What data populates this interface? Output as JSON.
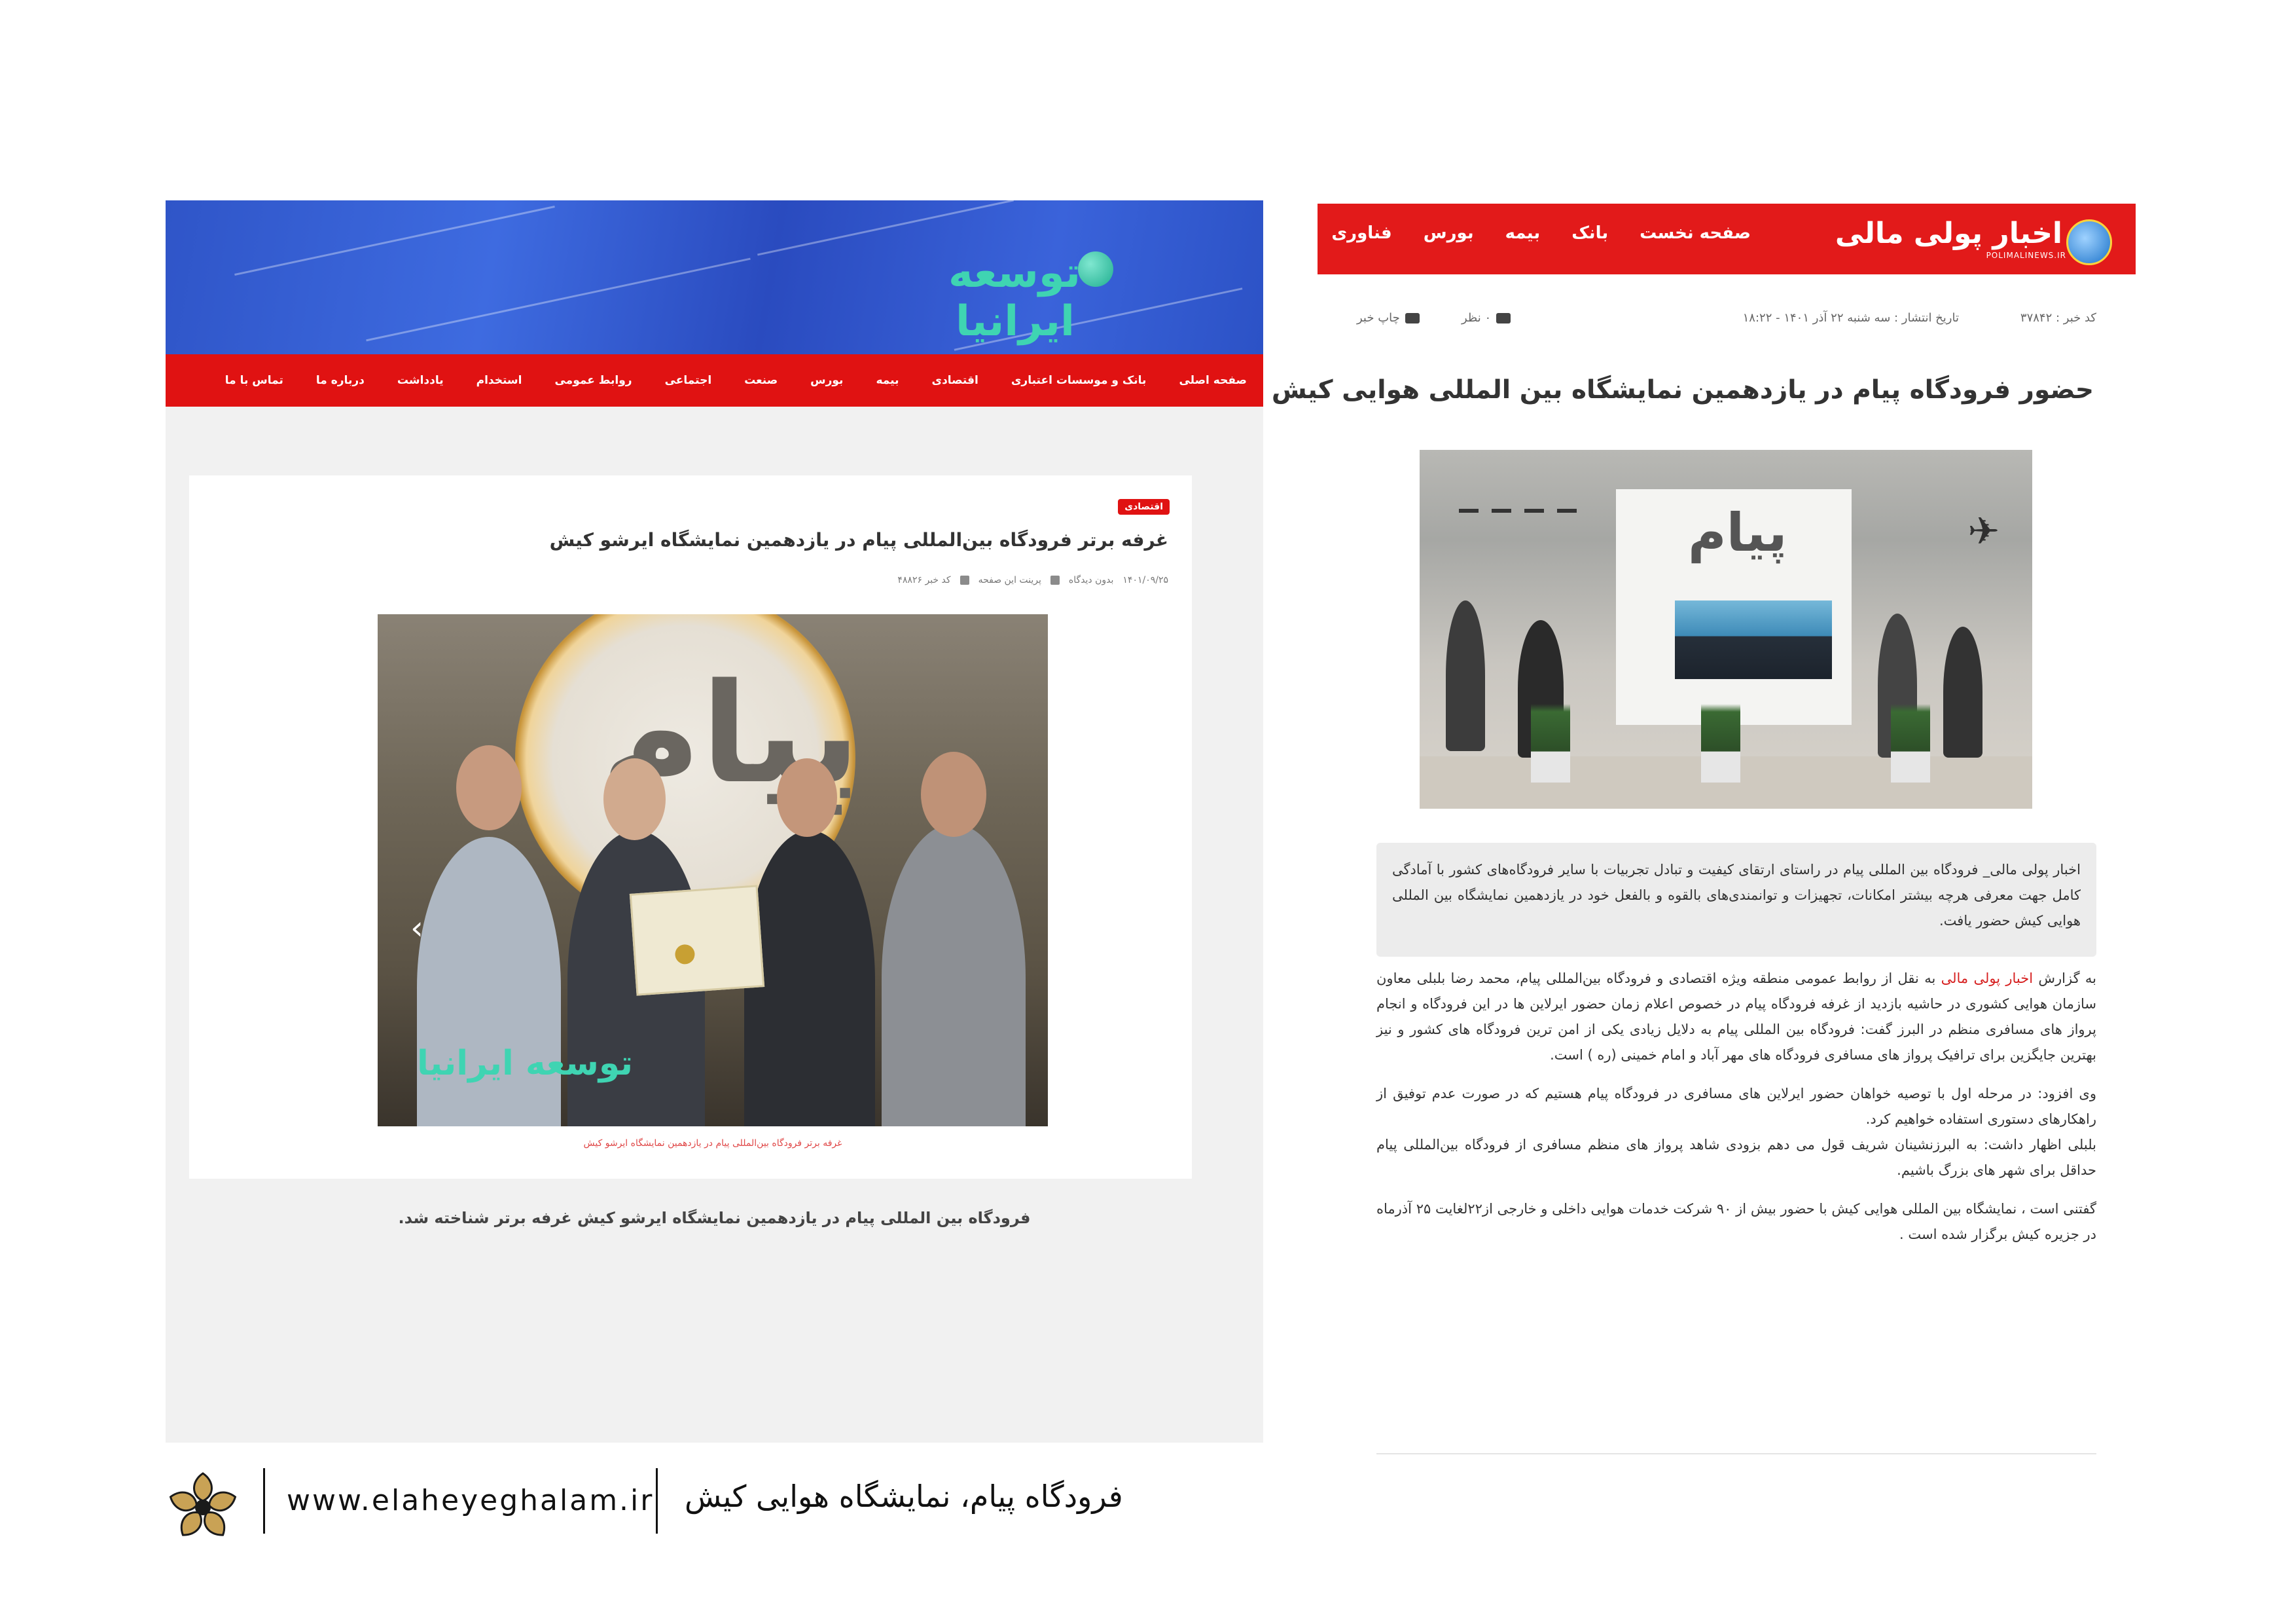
{
  "left_clip": {
    "logo_text": "توسعه ایرانیا",
    "nav": [
      "صفحه اصلی",
      "بانک و موسسات اعتباری",
      "اقتصادی",
      "بیمه",
      "بورس",
      "صنعت",
      "اجتماعی",
      "روابط عمومی",
      "استخدام",
      "یادداشت",
      "درباره ما",
      "تماس با ما"
    ],
    "category_badge": "اقتصادی",
    "title": "غرفه برتر فرودگاه بین‌المللی پیام در یازدهمین نمایشگاه ایرشو کیش",
    "meta": {
      "date": "۱۴۰۱/۰۹/۲۵",
      "views": "بدون دیدگاه",
      "print": "پرینت این صفحه",
      "code": "کد خبر ۴۸۸۲۶"
    },
    "photo_watermark": "توسعه ایرانیا",
    "photo_caption": "غرفه برتر فرودگاه بین‌المللی پیام در یازدهمین نمایشگاه ایرشو کیش",
    "lead": "فرودگاه بین المللی پیام در یازدهمین نمایشگاه ایرشو کیش غرفه برتر شناخته شد."
  },
  "right_clip": {
    "logo_text": "اخبار پولی مالی",
    "logo_sub": "POLIMALINEWS.IR",
    "nav": [
      "صفحه نخست",
      "بانک",
      "بیمه",
      "بورس",
      "فناوری"
    ],
    "meta": {
      "code": "کد خبر : ۳۷۸۴۲",
      "date": "تاریخ انتشار : سه شنبه ۲۲ آذر ۱۴۰۱ - ۱۸:۲۲",
      "views": "۰ نظر",
      "print": "چاپ خبر"
    },
    "title": "حضور فرودگاه پیام در یازدهمین نمایشگاه بین المللی هوایی کیش",
    "lead": "اخبار پولی مالی_ فرودگاه بین المللی پیام در راستای ارتقای کیفیت و تبادل تجربیات با سایر فرودگاه‌های کشور با آمادگی کامل جهت معرفی هرچه بیشتر امکانات، تجهیزات و توانمندی‌های بالقوه و بالفعل خود در یازدهمین نمایشگاه بین المللی هوایی کیش حضور یافت.",
    "body": {
      "p1_prefix": "به گزارش",
      "p1_link": "اخبار پولی مالی",
      "p1_rest": "به نقل از روابط عمومی منطقه ویژه اقتصادی و فرودگاه بین‌المللی پیام، محمد رضا بلبلی معاون سازمان هوایی کشوری در حاشیه بازدید از غرفه فرودگاه پیام در خصوص اعلام زمان حضور ایرلاین ها در این فرودگاه و انجام پرواز های مسافری منظم در البرز گفت: فرودگاه بین المللی پیام به دلایل زیادی یکی از امن ترین فرودگاه های کشور و نیز بهترین جایگزین برای ترافیک پرواز های مسافری فرودگاه های مهر آباد و امام خمینی (ره ) است.",
      "p2": "وی افزود: در مرحله اول با توصیه خواهان حضور ایرلاین های مسافری در فرودگاه پیام هستیم که در صورت عدم توفیق از راهکارهای دستوری استفاده خواهیم کرد.",
      "p3": "بلبلی اظهار داشت: به البرزنشینان شریف قول می دهم بزودی شاهد پرواز های منظم مسافری از فرودگاه بین‌المللی پیام حداقل برای شهر های بزرگ باشیم.",
      "p4": "گفتنی است ، نمایشگاه بین المللی هوایی کیش با حضور بیش از ۹۰ شرکت خدمات هوایی داخلی و خارجی از۲۲لغایت ۲۵ آذرماه در جزیره کیش برگزار شده است ."
    }
  },
  "footer": {
    "url": "www.elaheyeghalam.ir",
    "title": "فرودگاه پیام، نمایشگاه هوایی کیش"
  },
  "colors": {
    "nav_red": "#e01212",
    "banner_blue": "#2f55c8",
    "logo_teal": "#3fd4b2",
    "lead_gray": "#ececec",
    "link_red": "#d61e1e"
  }
}
